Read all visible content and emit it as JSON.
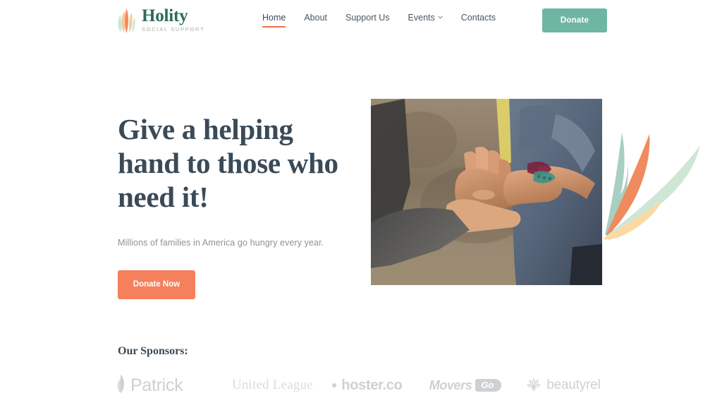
{
  "brand": {
    "name": "Holity",
    "tagline": "SOCIAL SUPPORT",
    "mark_icon": "leaf-fan-logo-icon"
  },
  "nav": {
    "items": [
      {
        "label": "Home",
        "active": true,
        "has_dropdown": false,
        "name": "nav-item-home"
      },
      {
        "label": "About",
        "active": false,
        "has_dropdown": false,
        "name": "nav-item-about"
      },
      {
        "label": "Support Us",
        "active": false,
        "has_dropdown": false,
        "name": "nav-item-support-us"
      },
      {
        "label": "Events",
        "active": false,
        "has_dropdown": true,
        "name": "nav-item-events"
      },
      {
        "label": "Contacts",
        "active": false,
        "has_dropdown": false,
        "name": "nav-item-contacts"
      }
    ]
  },
  "header": {
    "donate_label": "Donate"
  },
  "hero": {
    "title_line1": "Give a helping",
    "title_line2": "hand to those who",
    "title_line3": "need it!",
    "subtitle": "Millions of families in America go hungry every year.",
    "cta_label": "Donate Now",
    "image_alt": "two hands reaching toward each other"
  },
  "sponsors": {
    "title": "Our Sponsors:",
    "items": [
      {
        "label": "Patrick",
        "icon": "patrick-leaf-icon",
        "name": "sponsor-patrick"
      },
      {
        "label": "United League",
        "icon": "",
        "name": "sponsor-united-league"
      },
      {
        "label": "hoster.co",
        "icon": "hoster-dot-icon",
        "name": "sponsor-hoster-co"
      },
      {
        "label": "Movers",
        "badge": "Go",
        "icon": "",
        "name": "sponsor-movers-go"
      },
      {
        "label": "beautyrel",
        "icon": "lotus-icon",
        "name": "sponsor-beautyrel"
      }
    ]
  },
  "colors": {
    "teal": "#6fb6a2",
    "coral": "#f5805c",
    "heading": "#3a4a57",
    "brand_green": "#2f6b5e",
    "muted": "#8b9298",
    "sponsor_gray": "#cdd1d4",
    "leaf_sage": "#a8cfc0",
    "leaf_coral": "#f08a5f",
    "leaf_mint": "#cfe6d6",
    "leaf_peach": "#fbd9a0"
  }
}
